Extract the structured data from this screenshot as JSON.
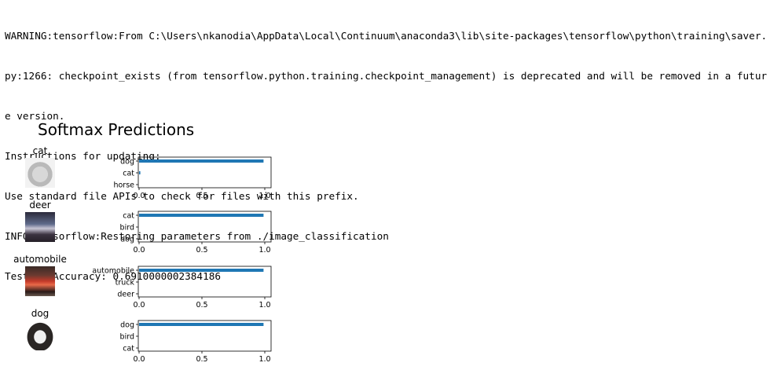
{
  "console": {
    "lines": [
      "WARNING:tensorflow:From C:\\Users\\nkanodia\\AppData\\Local\\Continuum\\anaconda3\\lib\\site-packages\\tensorflow\\python\\training\\saver.",
      "py:1266: checkpoint_exists (from tensorflow.python.training.checkpoint_management) is deprecated and will be removed in a futur",
      "e version.",
      "Instructions for updating:",
      "Use standard file APIs to check for files with this prefix.",
      "INFO:tensorflow:Restoring parameters from ./image_classification",
      "Testing Accuracy: 0.6910000002384186"
    ]
  },
  "figure": {
    "title": "Softmax Predictions"
  },
  "chart_data": [
    {
      "type": "bar",
      "orientation": "horizontal",
      "image_label": "cat",
      "categories": [
        "dog",
        "cat",
        "horse"
      ],
      "values": [
        0.99,
        0.01,
        0.0
      ],
      "xlim": [
        0.0,
        1.0
      ],
      "xticks": [
        "0.0",
        "0.5",
        "1.0"
      ]
    },
    {
      "type": "bar",
      "orientation": "horizontal",
      "image_label": "deer",
      "categories": [
        "cat",
        "bird",
        "dog"
      ],
      "values": [
        0.99,
        0.0,
        0.0
      ],
      "xlim": [
        0.0,
        1.0
      ],
      "xticks": [
        "0.0",
        "0.5",
        "1.0"
      ]
    },
    {
      "type": "bar",
      "orientation": "horizontal",
      "image_label": "automobile",
      "categories": [
        "automobile",
        "truck",
        "deer"
      ],
      "values": [
        0.99,
        0.0,
        0.0
      ],
      "xlim": [
        0.0,
        1.0
      ],
      "xticks": [
        "0.0",
        "0.5",
        "1.0"
      ]
    },
    {
      "type": "bar",
      "orientation": "horizontal",
      "image_label": "dog",
      "categories": [
        "dog",
        "bird",
        "cat"
      ],
      "values": [
        0.99,
        0.0,
        0.0
      ],
      "xlim": [
        0.0,
        1.0
      ],
      "xticks": [
        "0.0",
        "0.5",
        "1.0"
      ]
    }
  ],
  "colors": {
    "bar": "#1f77b4"
  }
}
